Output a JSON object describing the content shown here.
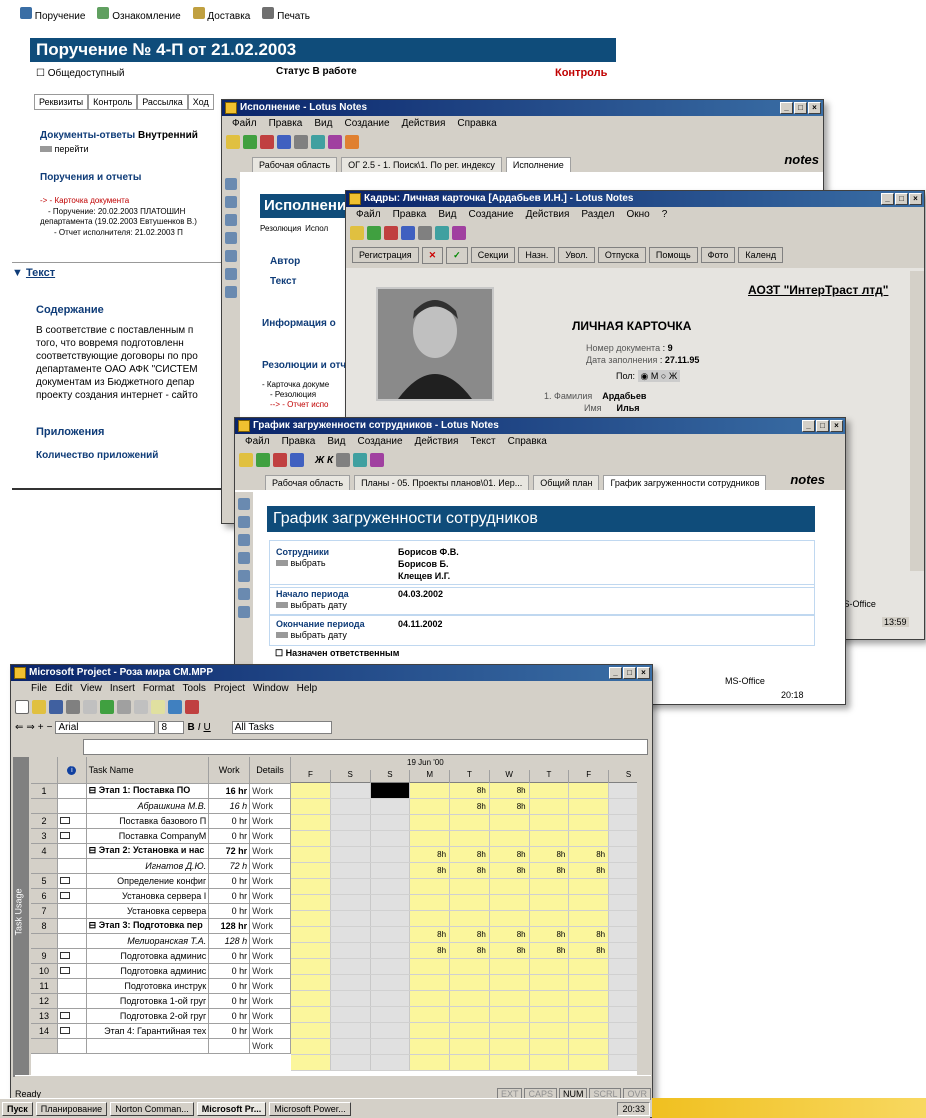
{
  "doc1": {
    "toolbar": [
      "Поручение",
      "Ознакомление",
      "Доставка",
      "Печать"
    ],
    "title": "Поручение  № 4-П от 21.02.2003",
    "public_label": "Общедоступный",
    "status_label": "Статус",
    "status_value": "В работе",
    "control": "Контроль",
    "tabs": [
      "Реквизиты",
      "Контроль",
      "Рассылка",
      "Ход"
    ],
    "docs_answers": "Документы-ответы",
    "docs_answers_val": "Внутренний",
    "goto": "перейти",
    "orders": "Поручения и отчеты",
    "card_link": "-> - Карточка документа",
    "order_line": "- Поручение: 20.02.2003 ПЛАТОШИН",
    "order_line2": "департамента (19.02.2003 Евтушенков В.)",
    "report_line": "- Отчет исполнителя: 21.02.2003 П",
    "text_section": "Текст",
    "content": "Содержание",
    "body_text": [
      "В соответствие с поставленным п",
      "того, что вовремя подготовленн",
      "соответствующие договоры по про",
      "департаменте ОАО АФК \"СИСТЕМ",
      "документам  из Бюджетного депар",
      "проекту создания интернет - сайто"
    ],
    "attachments": "Приложения",
    "attach_count": "Количество приложений"
  },
  "doc2": {
    "window_title": "Исполнение - Lotus Notes",
    "menu": [
      "Файл",
      "Правка",
      "Вид",
      "Создание",
      "Действия",
      "Справка"
    ],
    "tabs": [
      "Рабочая область",
      "ОГ 2.5 - 1. Поиск\\1. По рег. индексу",
      "Исполнение"
    ],
    "brand": "notes",
    "title": "Исполнени",
    "tabs2": [
      "Резолюция",
      "Испол"
    ],
    "author": "Автор",
    "text": "Текст",
    "info": "Информация о",
    "resolutions": "Резолюции и отч",
    "res1": "- Карточка докуме",
    "res2": "- Резолюция",
    "res3": "--> - Отчет испо"
  },
  "doc3": {
    "window_title": "Кадры: Личная карточка [Ардабьев И.Н.] - Lotus Notes",
    "menu": [
      "Файл",
      "Правка",
      "Вид",
      "Создание",
      "Действия",
      "Раздел",
      "Окно",
      "?"
    ],
    "buttons": [
      "Регистрация",
      "Секции",
      "Назн.",
      "Увол.",
      "Отпуска",
      "Помощь",
      "Фото",
      "Календ"
    ],
    "company": "АОЗТ \"ИнтерТраст лтд\"",
    "card_title": "ЛИЧНАЯ КАРТОЧКА",
    "docnum_label": "Номер документа",
    "docnum": "9",
    "date_label": "Дата заполнения",
    "date": "27.11.95",
    "sex_label": "Пол",
    "sex_m": "М",
    "sex_f": "Ж",
    "surname_label": "1. Фамилия",
    "surname": "Ардабьев",
    "name_label": "Имя",
    "name": "Илья",
    "office": "MS-Office",
    "time": "13:59"
  },
  "doc4": {
    "window_title": "График загруженности сотрудников - Lotus Notes",
    "menu": [
      "Файл",
      "Правка",
      "Вид",
      "Создание",
      "Действия",
      "Текст",
      "Справка"
    ],
    "tabs": [
      "Рабочая область",
      "Планы - 05. Проекты планов\\01. Иер...",
      "Общий план",
      "График загруженности сотрудников"
    ],
    "brand": "notes",
    "title": "График загруженности сотрудников",
    "employees_label": "Сотрудники",
    "choose": "выбрать",
    "employees": [
      "Борисов Ф.В.",
      "Борисов Б.",
      "Клещев И.Г."
    ],
    "start_label": "Начало периода",
    "choose_date": "выбрать дату",
    "start": "04.03.2002",
    "end_label": "Окончание периода",
    "end": "04.11.2002",
    "responsible": "Назначен ответственным",
    "office": "MS-Office",
    "time": "20:18"
  },
  "project": {
    "window_title": "Microsoft Project - Роза мира СМ.MPP",
    "menu": [
      "File",
      "Edit",
      "View",
      "Insert",
      "Format",
      "Tools",
      "Project",
      "Window",
      "Help"
    ],
    "font": "Arial",
    "size": "8",
    "filter": "All Tasks",
    "side_label": "Task Usage",
    "headers": {
      "name": "Task Name",
      "work": "Work",
      "details": "Details"
    },
    "week": "19 Jun '00",
    "days": [
      "F",
      "S",
      "S",
      "M",
      "T",
      "W",
      "T",
      "F",
      "S"
    ],
    "rows": [
      {
        "id": "1",
        "name": "⊟ Этап 1: Поставка ПО",
        "work": "16 hr",
        "bold": true,
        "cells": [
          "",
          "",
          "",
          "",
          "8h",
          "8h",
          "",
          "",
          ""
        ]
      },
      {
        "id": "",
        "name": "Абрашкина М.В.",
        "work": "16 h",
        "italic": true,
        "cells": [
          "",
          "",
          "",
          "",
          "8h",
          "8h",
          "",
          "",
          ""
        ]
      },
      {
        "id": "2",
        "name": "Поставка базового П",
        "work": "0 hr",
        "cells": [
          "",
          "",
          "",
          "",
          "",
          "",
          "",
          "",
          ""
        ]
      },
      {
        "id": "3",
        "name": "Поставка CompanyM",
        "work": "0 hr",
        "cells": [
          "",
          "",
          "",
          "",
          "",
          "",
          "",
          "",
          ""
        ]
      },
      {
        "id": "4",
        "name": "⊟ Этап 2: Установка и нас",
        "work": "72 hr",
        "bold": true,
        "cells": [
          "",
          "",
          "",
          "8h",
          "8h",
          "8h",
          "8h",
          "8h",
          ""
        ]
      },
      {
        "id": "",
        "name": "Игнатов Д.Ю.",
        "work": "72 h",
        "italic": true,
        "cells": [
          "",
          "",
          "",
          "8h",
          "8h",
          "8h",
          "8h",
          "8h",
          ""
        ]
      },
      {
        "id": "5",
        "name": "Определение конфиг",
        "work": "0 hr",
        "cells": [
          "",
          "",
          "",
          "",
          "",
          "",
          "",
          "",
          ""
        ]
      },
      {
        "id": "6",
        "name": "Установка сервера I",
        "work": "0 hr",
        "cells": [
          "",
          "",
          "",
          "",
          "",
          "",
          "",
          "",
          ""
        ]
      },
      {
        "id": "7",
        "name": "Установка сервера",
        "work": "0 hr",
        "cells": [
          "",
          "",
          "",
          "",
          "",
          "",
          "",
          "",
          ""
        ]
      },
      {
        "id": "8",
        "name": "⊟ Этап 3: Подготовка пер",
        "work": "128 hr",
        "bold": true,
        "cells": [
          "",
          "",
          "",
          "8h",
          "8h",
          "8h",
          "8h",
          "8h",
          ""
        ]
      },
      {
        "id": "",
        "name": "Мелиоранская Т.А.",
        "work": "128 h",
        "italic": true,
        "cells": [
          "",
          "",
          "",
          "8h",
          "8h",
          "8h",
          "8h",
          "8h",
          ""
        ]
      },
      {
        "id": "9",
        "name": "Подготовка админис",
        "work": "0 hr",
        "cells": [
          "",
          "",
          "",
          "",
          "",
          "",
          "",
          "",
          ""
        ]
      },
      {
        "id": "10",
        "name": "Подготовка админис",
        "work": "0 hr",
        "cells": [
          "",
          "",
          "",
          "",
          "",
          "",
          "",
          "",
          ""
        ]
      },
      {
        "id": "11",
        "name": "Подготовка инструк",
        "work": "0 hr",
        "cells": [
          "",
          "",
          "",
          "",
          "",
          "",
          "",
          "",
          ""
        ]
      },
      {
        "id": "12",
        "name": "Подготовка 1-ой груг",
        "work": "0 hr",
        "cells": [
          "",
          "",
          "",
          "",
          "",
          "",
          "",
          "",
          ""
        ]
      },
      {
        "id": "13",
        "name": "Подготовка 2-ой груг",
        "work": "0 hr",
        "cells": [
          "",
          "",
          "",
          "",
          "",
          "",
          "",
          "",
          ""
        ]
      },
      {
        "id": "14",
        "name": "Этап 4: Гарантийная тех",
        "work": "0 hr",
        "cells": [
          "",
          "",
          "",
          "",
          "",
          "",
          "",
          "",
          ""
        ]
      }
    ],
    "work_label": "Work",
    "status": "Ready",
    "ind": [
      "EXT",
      "CAPS",
      "NUM",
      "SCRL",
      "OVR"
    ],
    "taskbar": [
      "Пуск",
      "Планирование",
      "Norton Comman...",
      "Microsoft Pr...",
      "Microsoft Power..."
    ],
    "time": "20:33"
  }
}
